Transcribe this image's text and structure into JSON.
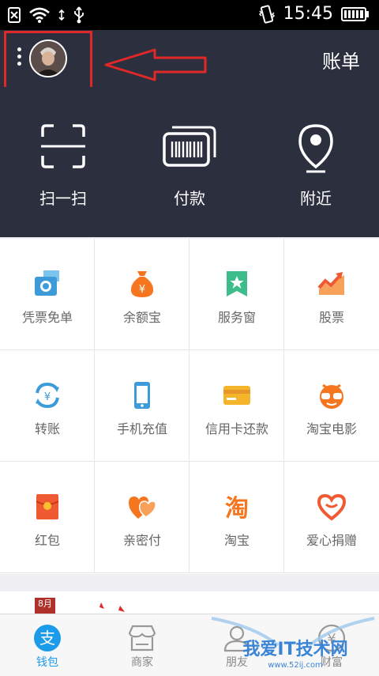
{
  "status_bar": {
    "time": "15:45"
  },
  "header": {
    "title": "账单"
  },
  "quick_actions": [
    {
      "label": "扫一扫"
    },
    {
      "label": "付款"
    },
    {
      "label": "附近"
    }
  ],
  "grid": [
    {
      "label": "凭票免单",
      "icon": "ticket-camera-icon",
      "color": "#3d9bd9"
    },
    {
      "label": "余额宝",
      "icon": "money-bag-icon",
      "color": "#f5761f"
    },
    {
      "label": "服务窗",
      "icon": "service-star-icon",
      "color": "#3dbc8c"
    },
    {
      "label": "股票",
      "icon": "stock-chart-icon",
      "color": "#f5761f"
    },
    {
      "label": "转账",
      "icon": "transfer-icon",
      "color": "#3d9bd9"
    },
    {
      "label": "手机充值",
      "icon": "phone-topup-icon",
      "color": "#3d9bd9"
    },
    {
      "label": "信用卡还款",
      "icon": "credit-card-icon",
      "color": "#f5b52b"
    },
    {
      "label": "淘宝电影",
      "icon": "movie-glasses-icon",
      "color": "#f5761f"
    },
    {
      "label": "红包",
      "icon": "red-envelope-icon",
      "color": "#f05a32"
    },
    {
      "label": "亲密付",
      "icon": "hearts-icon",
      "color": "#f5761f"
    },
    {
      "label": "淘宝",
      "icon": "taobao-icon",
      "color": "#f5761f"
    },
    {
      "label": "爱心捐赠",
      "icon": "love-donate-icon",
      "color": "#f05a32"
    }
  ],
  "banner": {
    "badge": "8月"
  },
  "tabs": [
    {
      "label": "钱包",
      "icon_glyph": "支"
    },
    {
      "label": "商家"
    },
    {
      "label": "朋友"
    },
    {
      "label": "财富",
      "icon_glyph": "¥"
    }
  ],
  "watermark": {
    "text": "我爱IT技术网",
    "site": "www.52ij.com"
  },
  "colors": {
    "header_bg": "#2b2f3e",
    "accent": "#1b9bea",
    "annotation": "#e02828"
  }
}
